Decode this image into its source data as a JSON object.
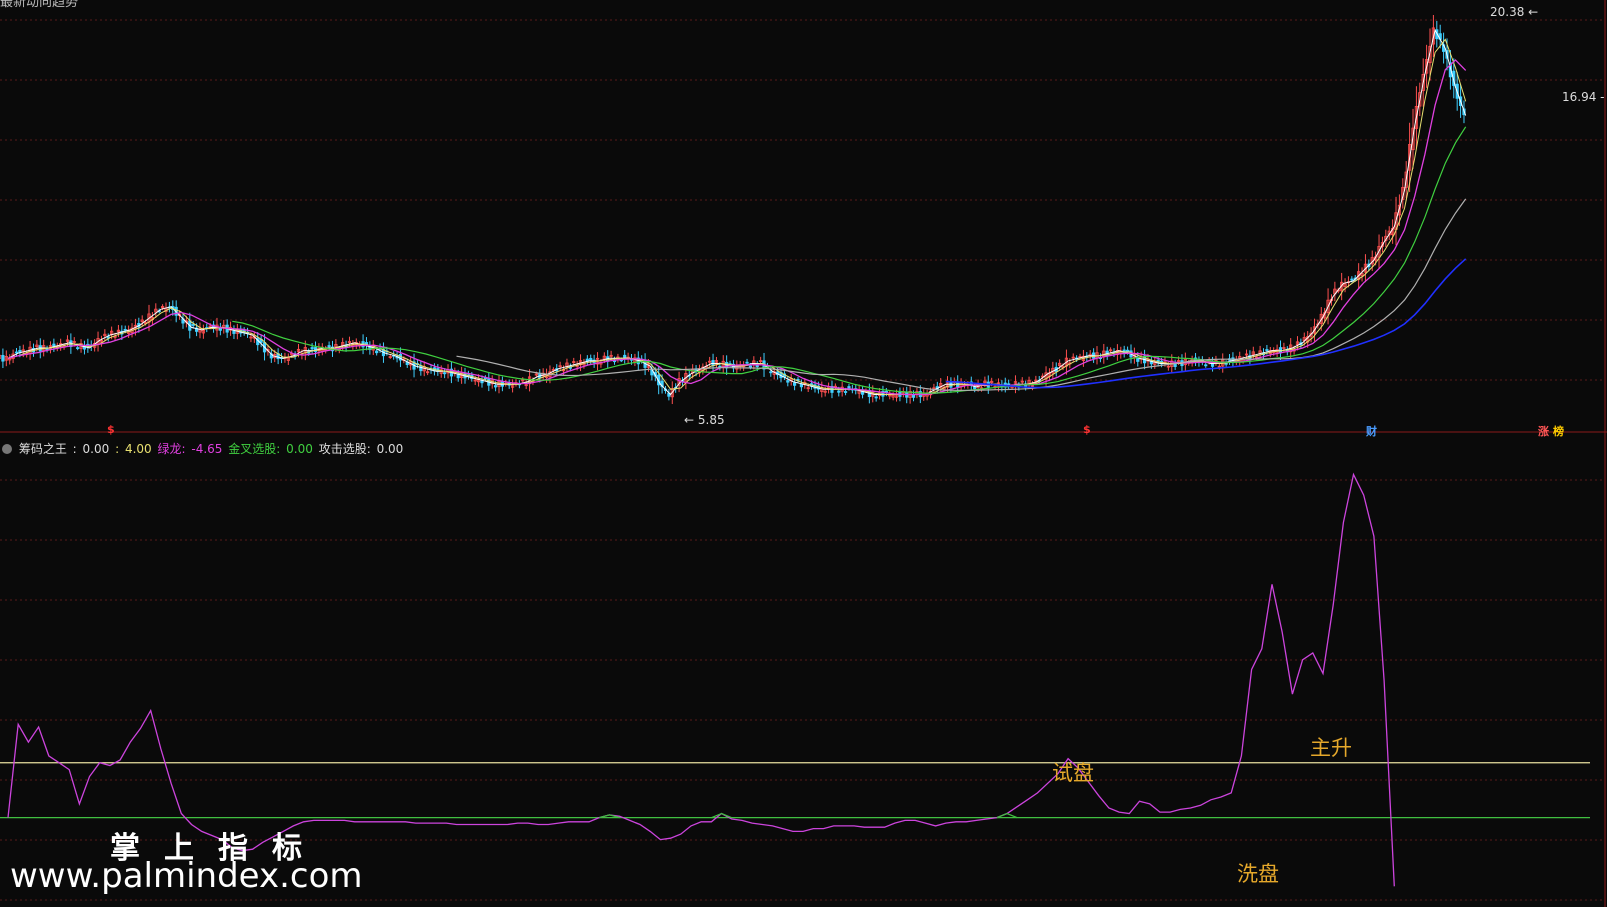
{
  "window": {
    "title_clipped": "最新动向趋势"
  },
  "indicator_legend": {
    "name": "筹码之王",
    "v1": "0.00",
    "v2": "4.00",
    "green_dragon_label": "绿龙:",
    "green_dragon_value": "-4.65",
    "golden_cross_label": "金叉选股:",
    "golden_cross_value": "0.00",
    "attack_label": "攻击选股:",
    "attack_value": "0.00"
  },
  "price_panel": {
    "high_label": "20.38",
    "low_label": "5.85",
    "last_label": "16.94",
    "markers": [
      {
        "id": "s1",
        "text": "$",
        "color": "#ff3333"
      },
      {
        "id": "s2",
        "text": "$",
        "color": "#ff3333"
      },
      {
        "id": "cai",
        "text": "财",
        "color": "#4a9cff"
      },
      {
        "id": "zhang",
        "text": "涨",
        "color": "#ff5555"
      },
      {
        "id": "bang",
        "text": "榜",
        "color": "#ffcc00"
      }
    ]
  },
  "annotations": {
    "trial": "试盘",
    "main_rise": "主升",
    "wash": "洗盘"
  },
  "watermark": {
    "brand": "掌上指标",
    "url": "www.palmindex.com"
  },
  "colors": {
    "background": "#0a0a0a",
    "grid": "#5a1a1a",
    "divider": "#8a1a1a",
    "candle_up": "#ff5050",
    "candle_down": "#40d0ff",
    "ma_white": "#ffffff",
    "ma_yellow": "#e8e070",
    "ma_magenta": "#e040e0",
    "ma_green": "#40d040",
    "ma_gray": "#b0b0b0",
    "ma_blue": "#2030ff",
    "indicator": "#cc44dd",
    "upper_band": "#e8e0a0",
    "lower_band": "#40c040",
    "annotation": "#e5a82b"
  },
  "chart_data": [
    {
      "type": "line",
      "panel": "price (candlestick with moving averages)",
      "x": [
        0,
        10,
        20,
        30,
        40,
        50,
        60,
        70,
        80,
        90,
        100,
        110,
        120,
        130,
        140,
        150,
        160,
        170,
        180,
        190,
        200,
        210,
        220,
        230,
        240,
        250,
        260,
        270,
        280,
        290,
        300,
        310,
        320,
        330,
        340,
        350,
        360,
        370,
        380,
        390,
        400,
        410,
        420,
        430,
        440,
        450,
        460,
        470,
        480,
        490,
        500,
        510,
        520,
        530,
        540,
        550,
        560,
        570,
        580,
        590,
        600,
        610,
        620,
        630,
        640,
        650,
        660,
        670,
        680,
        690,
        700,
        710,
        720,
        730,
        740,
        750,
        760,
        770,
        780,
        790,
        800,
        810,
        820,
        830,
        840,
        850,
        860,
        870,
        880,
        890,
        900,
        910,
        920,
        930,
        940,
        950,
        960,
        970,
        980,
        990,
        1000,
        1010,
        1020,
        1030,
        1040,
        1050,
        1060,
        1070,
        1080,
        1090,
        1100,
        1110,
        1120,
        1130,
        1140,
        1150,
        1160,
        1170,
        1180,
        1190,
        1200,
        1210,
        1220,
        1230,
        1240,
        1250,
        1260,
        1270,
        1280,
        1290,
        1300,
        1310,
        1320,
        1330,
        1340,
        1350,
        1360,
        1370,
        1380,
        1390,
        1400,
        1410,
        1420,
        1430,
        1440,
        1450,
        1460,
        1470,
        1480,
        1490,
        1500,
        1510,
        1520,
        1530,
        1540,
        1550
      ],
      "close": [
        7.5,
        7.7,
        7.8,
        7.9,
        7.9,
        8.0,
        8.1,
        8.0,
        7.9,
        8.2,
        8.4,
        8.5,
        8.6,
        8.8,
        9.1,
        9.4,
        9.5,
        9.1,
        8.7,
        8.6,
        8.7,
        8.7,
        8.6,
        8.5,
        8.4,
        8.0,
        7.6,
        7.5,
        7.6,
        7.8,
        7.8,
        7.9,
        7.9,
        8.0,
        8.1,
        8.0,
        7.9,
        7.7,
        7.6,
        7.4,
        7.2,
        7.1,
        7.0,
        7.0,
        6.9,
        6.8,
        6.7,
        6.6,
        6.5,
        6.5,
        6.5,
        6.6,
        6.8,
        6.9,
        7.1,
        7.2,
        7.3,
        7.4,
        7.4,
        7.5,
        7.5,
        7.5,
        7.4,
        7.2,
        6.5,
        6.1,
        6.6,
        6.9,
        7.1,
        7.3,
        7.3,
        7.2,
        7.2,
        7.3,
        7.3,
        7.0,
        6.8,
        6.6,
        6.5,
        6.4,
        6.3,
        6.3,
        6.3,
        6.3,
        6.2,
        6.1,
        6.1,
        6.1,
        6.1,
        6.1,
        6.1,
        6.3,
        6.5,
        6.5,
        6.5,
        6.4,
        6.5,
        6.5,
        6.4,
        6.5,
        6.5,
        6.6,
        6.9,
        7.1,
        7.4,
        7.5,
        7.6,
        7.6,
        7.7,
        7.8,
        7.7,
        7.5,
        7.4,
        7.3,
        7.3,
        7.3,
        7.4,
        7.4,
        7.3,
        7.3,
        7.4,
        7.5,
        7.6,
        7.7,
        7.8,
        7.8,
        7.9,
        8.1,
        8.5,
        9.1,
        9.9,
        10.4,
        10.5,
        10.9,
        11.3,
        12.0,
        12.6,
        14.0,
        16.5,
        18.5,
        20.2,
        19.5,
        18.0,
        16.9
      ],
      "high_label": 20.38,
      "low_label": 5.85,
      "last_label": 16.94
    },
    {
      "type": "line",
      "panel": "indicator (筹码之王)",
      "x": [
        0,
        10,
        20,
        30,
        40,
        50,
        60,
        70,
        80,
        90,
        100,
        110,
        120,
        130,
        140,
        150,
        160,
        170,
        180,
        190,
        200,
        210,
        220,
        230,
        240,
        250,
        260,
        270,
        280,
        290,
        300,
        310,
        320,
        330,
        340,
        350,
        360,
        370,
        380,
        390,
        400,
        410,
        420,
        430,
        440,
        450,
        460,
        470,
        480,
        490,
        500,
        510,
        520,
        530,
        540,
        550,
        560,
        570,
        580,
        590,
        600,
        610,
        620,
        630,
        640,
        650,
        660,
        670,
        680,
        690,
        700,
        710,
        720,
        730,
        740,
        750,
        760,
        770,
        780,
        790,
        800,
        810,
        820,
        830,
        840,
        850,
        860,
        870,
        880,
        890,
        900,
        910,
        920,
        930,
        940,
        950,
        960,
        970,
        980,
        990,
        1000,
        1010,
        1020,
        1030,
        1040,
        1050,
        1060,
        1070,
        1080,
        1090,
        1100,
        1110,
        1120,
        1130,
        1140,
        1150,
        1160,
        1170,
        1180,
        1190,
        1200,
        1210,
        1220,
        1230,
        1240,
        1250,
        1260,
        1270,
        1280,
        1290,
        1300,
        1310,
        1320,
        1330,
        1340,
        1350,
        1360,
        1370,
        1380,
        1390,
        1400,
        1410,
        1420,
        1430,
        1440,
        1450,
        1460,
        1470,
        1480,
        1490,
        1500,
        1510,
        1520,
        1530,
        1540,
        1550
      ],
      "values": [
        0.0,
        6.8,
        5.5,
        6.6,
        4.5,
        4.0,
        3.5,
        1.0,
        3.0,
        4.0,
        3.8,
        4.2,
        5.5,
        6.5,
        7.8,
        5.0,
        2.5,
        0.3,
        -0.5,
        -1.0,
        -1.3,
        -1.6,
        -2.2,
        -2.4,
        -2.3,
        -1.8,
        -1.4,
        -1.0,
        -0.6,
        -0.3,
        -0.2,
        -0.2,
        -0.2,
        -0.2,
        -0.3,
        -0.3,
        -0.3,
        -0.3,
        -0.3,
        -0.3,
        -0.4,
        -0.4,
        -0.4,
        -0.4,
        -0.5,
        -0.5,
        -0.5,
        -0.5,
        -0.5,
        -0.5,
        -0.4,
        -0.4,
        -0.5,
        -0.5,
        -0.4,
        -0.3,
        -0.3,
        -0.3,
        0.0,
        0.2,
        0.1,
        -0.2,
        -0.5,
        -1.0,
        -1.6,
        -1.5,
        -1.2,
        -0.6,
        -0.3,
        -0.3,
        0.3,
        -0.1,
        -0.2,
        -0.4,
        -0.5,
        -0.6,
        -0.8,
        -1.0,
        -1.0,
        -0.8,
        -0.8,
        -0.6,
        -0.6,
        -0.6,
        -0.7,
        -0.7,
        -0.7,
        -0.4,
        -0.2,
        -0.2,
        -0.4,
        -0.6,
        -0.4,
        -0.3,
        -0.3,
        -0.2,
        -0.1,
        0.0,
        0.3,
        0.8,
        1.3,
        1.8,
        2.5,
        3.2,
        4.3,
        3.6,
        2.6,
        1.6,
        0.7,
        0.4,
        0.3,
        1.2,
        1.0,
        0.4,
        0.4,
        0.6,
        0.7,
        0.9,
        1.3,
        1.5,
        1.8,
        4.5,
        10.8,
        12.3,
        17.0,
        13.5,
        9.0,
        11.5,
        12.0,
        10.5,
        15.5,
        21.5,
        25.0,
        23.5,
        20.5,
        10.0,
        -5.0
      ],
      "reference_lines": [
        4.0,
        0.0
      ]
    }
  ]
}
